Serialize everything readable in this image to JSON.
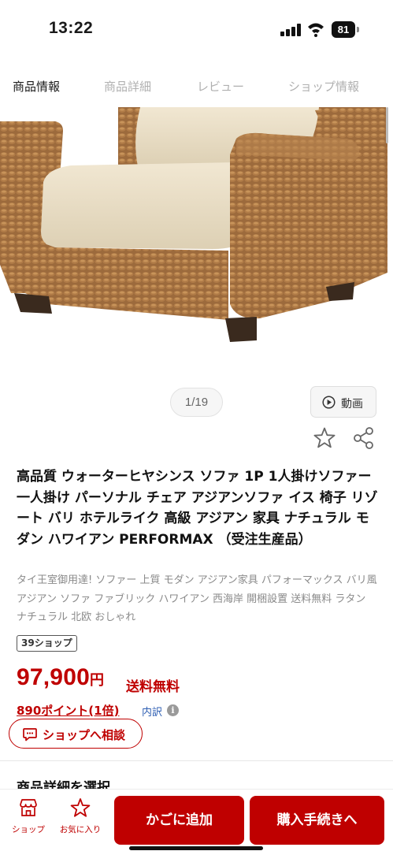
{
  "status": {
    "time": "13:22",
    "battery": "81"
  },
  "tabs": [
    {
      "label": "商品情報",
      "active": true
    },
    {
      "label": "商品詳細",
      "active": false
    },
    {
      "label": "レビュー",
      "active": false
    },
    {
      "label": "ショップ情報",
      "active": false
    }
  ],
  "gallery": {
    "counter": "1/19",
    "video_label": "動画"
  },
  "product": {
    "title": "高品質 ウォーターヒヤシンス ソファ 1P 1人掛けソファー 一人掛け パーソナル チェア アジアンソファ イス 椅子 リゾート バリ ホテルライク 高級 アジアン 家具 ナチュラル モダン ハワイアン PERFORMAX （受注生産品）",
    "catch_copy": "タイ王室御用達! ソファー 上質 モダン アジアン家具 パフォーマックス バリ風 アジアン ソファ ファブリック ハワイアン 西海岸 開梱設置 送料無料 ラタン ナチュラル 北欧 おしゃれ",
    "shop_badge": "39ショップ",
    "price": "97,900",
    "price_unit": "円",
    "shipping": "送料無料",
    "points": "890ポイント(1倍)",
    "points_detail": "内訳",
    "consult_label": "ショップへ相談"
  },
  "section": {
    "heading": "商品詳細を選択"
  },
  "bottom_bar": {
    "shop_label": "ショップ",
    "favorite_label": "お気に入り",
    "cart_label": "かごに追加",
    "buy_label": "購入手続きへ"
  },
  "colors": {
    "accent": "#bf0000",
    "link": "#2f5fb3"
  },
  "icons": [
    "signal-icon",
    "wifi-icon",
    "play-icon",
    "star-icon",
    "share-icon",
    "info-icon",
    "chat-icon",
    "shop-icon",
    "favorite-star-icon"
  ]
}
